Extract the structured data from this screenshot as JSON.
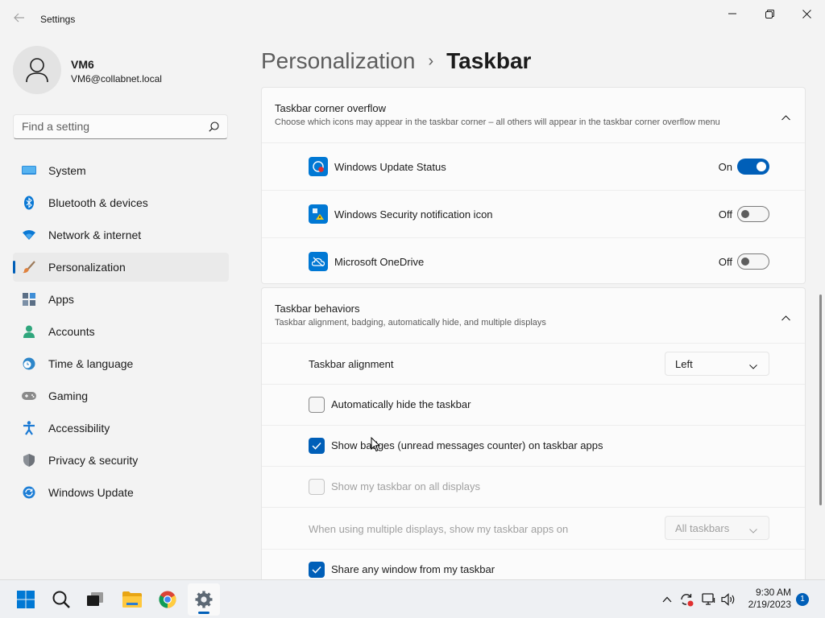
{
  "window": {
    "title": "Settings"
  },
  "user": {
    "name": "VM6",
    "email": "VM6@collabnet.local"
  },
  "search": {
    "placeholder": "Find a setting"
  },
  "sidebar": {
    "items": [
      {
        "label": "System",
        "icon": "system-icon"
      },
      {
        "label": "Bluetooth & devices",
        "icon": "bluetooth-icon"
      },
      {
        "label": "Network & internet",
        "icon": "wifi-icon"
      },
      {
        "label": "Personalization",
        "icon": "brush-icon",
        "active": true
      },
      {
        "label": "Apps",
        "icon": "apps-icon"
      },
      {
        "label": "Accounts",
        "icon": "person-icon"
      },
      {
        "label": "Time & language",
        "icon": "clock-globe-icon"
      },
      {
        "label": "Gaming",
        "icon": "gamepad-icon"
      },
      {
        "label": "Accessibility",
        "icon": "accessibility-icon"
      },
      {
        "label": "Privacy & security",
        "icon": "shield-icon"
      },
      {
        "label": "Windows Update",
        "icon": "update-icon"
      }
    ]
  },
  "breadcrumb": {
    "parent": "Personalization",
    "separator": "›",
    "current": "Taskbar"
  },
  "corner_overflow": {
    "title": "Taskbar corner overflow",
    "subtitle": "Choose which icons may appear in the taskbar corner – all others will appear in the taskbar corner overflow menu",
    "items": [
      {
        "label": "Windows Update Status",
        "state": "On",
        "on": true
      },
      {
        "label": "Windows Security notification icon",
        "state": "Off",
        "on": false
      },
      {
        "label": "Microsoft OneDrive",
        "state": "Off",
        "on": false
      }
    ]
  },
  "behaviors": {
    "title": "Taskbar behaviors",
    "subtitle": "Taskbar alignment, badging, automatically hide, and multiple displays",
    "alignment_label": "Taskbar alignment",
    "alignment_value": "Left",
    "auto_hide_label": "Automatically hide the taskbar",
    "auto_hide_checked": false,
    "badges_label": "Show badges (unread messages counter) on taskbar apps",
    "badges_checked": true,
    "all_displays_label": "Show my taskbar on all displays",
    "all_displays_checked": false,
    "multi_display_label": "When using multiple displays, show my taskbar apps on",
    "multi_display_value": "All taskbars",
    "share_label": "Share any window from my taskbar",
    "share_checked": true
  },
  "taskbar": {
    "time": "9:30 AM",
    "date": "2/19/2023",
    "notification_count": "1"
  },
  "colors": {
    "accent": "#005fb8",
    "background": "#f3f3f3",
    "card": "#fbfbfb"
  }
}
